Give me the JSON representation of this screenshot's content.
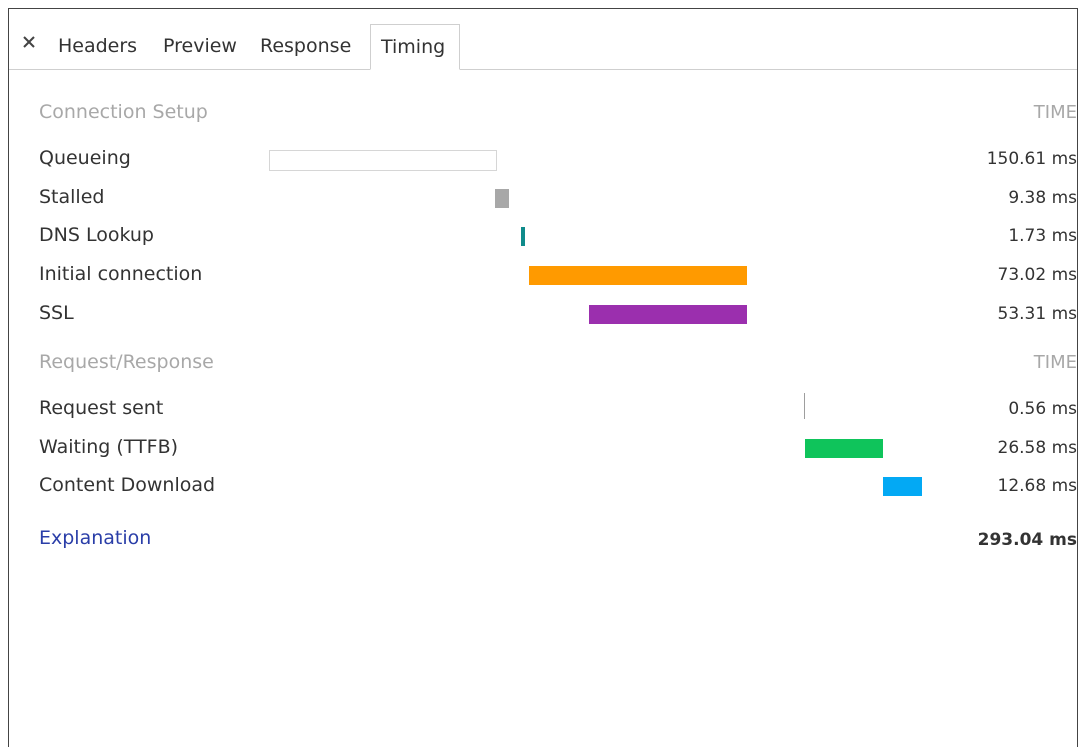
{
  "tabs": {
    "close_icon": "close-icon",
    "items": [
      "Headers",
      "Preview",
      "Response",
      "Timing"
    ],
    "active": "Timing"
  },
  "connection_setup": {
    "title": "Connection Setup",
    "col_head": "TIME",
    "rows": [
      {
        "label": "Queueing",
        "time": "150.61 ms",
        "start_ms": 0,
        "duration_ms": 150.61,
        "color": "#ffffff"
      },
      {
        "label": "Stalled",
        "time": "9.38 ms",
        "start_ms": 150.61,
        "duration_ms": 9.38,
        "color": "#a8a8a8"
      },
      {
        "label": "DNS Lookup",
        "time": "1.73 ms",
        "start_ms": 168.0,
        "duration_ms": 1.73,
        "color": "#0f8b8b"
      },
      {
        "label": "Initial connection",
        "time": "73.02 ms",
        "start_ms": 173.5,
        "duration_ms": 145.25,
        "color": "#ff9a00"
      },
      {
        "label": "SSL",
        "time": "53.31 ms",
        "start_ms": 213.0,
        "duration_ms": 105.75,
        "color": "#9b2fae"
      }
    ]
  },
  "request_response": {
    "title": "Request/Response",
    "col_head": "TIME",
    "rows": [
      {
        "label": "Request sent",
        "time": "0.56 ms",
        "start_ms": 356.5,
        "duration_ms": 0.56,
        "color": "#9e9e9e"
      },
      {
        "label": "Waiting (TTFB)",
        "time": "26.58 ms",
        "start_ms": 357.06,
        "duration_ms": 52.5,
        "color": "#0fc45b"
      },
      {
        "label": "Content Download",
        "time": "12.68 ms",
        "start_ms": 409.56,
        "duration_ms": 25.5,
        "color": "#03a9f4"
      }
    ]
  },
  "footer": {
    "explanation": "Explanation",
    "total": "293.04 ms"
  }
}
